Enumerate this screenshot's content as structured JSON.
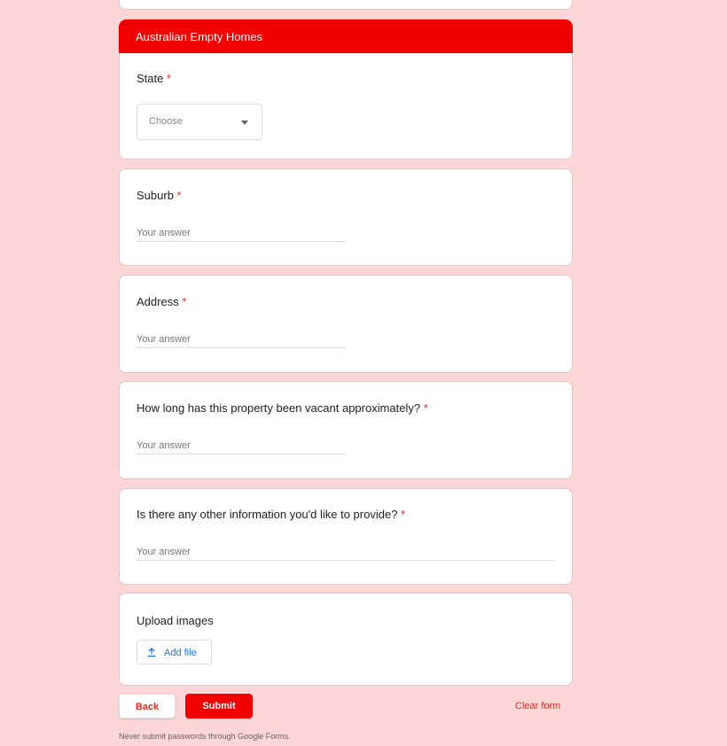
{
  "section": {
    "title": "Australian Empty Homes"
  },
  "questions": {
    "state": {
      "label": "State",
      "required_mark": "*",
      "dropdown_value": "Choose"
    },
    "suburb": {
      "label": "Suburb",
      "required_mark": "*",
      "answer_placeholder": "Your answer"
    },
    "address": {
      "label": "Address",
      "required_mark": "*",
      "answer_placeholder": "Your answer"
    },
    "vacant": {
      "label": "How long has this property been vacant approximately?",
      "required_mark": "*",
      "answer_placeholder": "Your answer"
    },
    "other_info": {
      "label": "Is there any other information you'd like to provide?",
      "required_mark": "*",
      "answer_placeholder": "Your answer"
    },
    "upload": {
      "label": "Upload images",
      "button_label": "Add file"
    }
  },
  "actions": {
    "back_label": "Back",
    "submit_label": "Submit",
    "clear_label": "Clear form"
  },
  "footer": {
    "note": "Never submit passwords through Google Forms."
  },
  "colors": {
    "background": "#fdd7d7",
    "accent": "#f20000",
    "required": "#d93025",
    "link_blue": "#1a73e8"
  },
  "icons": {
    "dropdown": "chevron-down-icon",
    "upload": "upload-icon"
  }
}
